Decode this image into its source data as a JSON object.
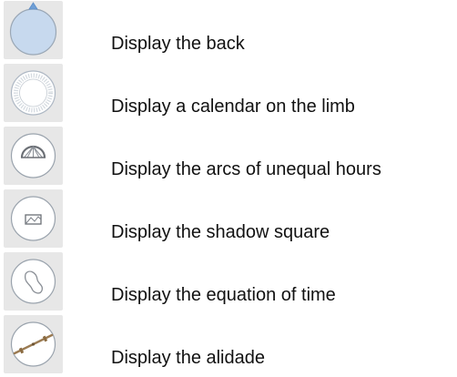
{
  "items": [
    {
      "label": "Display the back",
      "icon": "back-disc-icon"
    },
    {
      "label": "Display a calendar on the limb",
      "icon": "calendar-limb-icon"
    },
    {
      "label": "Display the arcs of unequal hours",
      "icon": "unequal-hours-arcs-icon"
    },
    {
      "label": "Display the shadow square",
      "icon": "shadow-square-icon"
    },
    {
      "label": "Display the equation of time",
      "icon": "equation-of-time-icon"
    },
    {
      "label": "Display the alidade",
      "icon": "alidade-icon"
    }
  ],
  "colors": {
    "button_background": "#e7e7e7",
    "disc_fill_active": "#c7d9ee",
    "disc_stroke": "#9aa7b5",
    "alidade_color": "#9b7b52"
  }
}
